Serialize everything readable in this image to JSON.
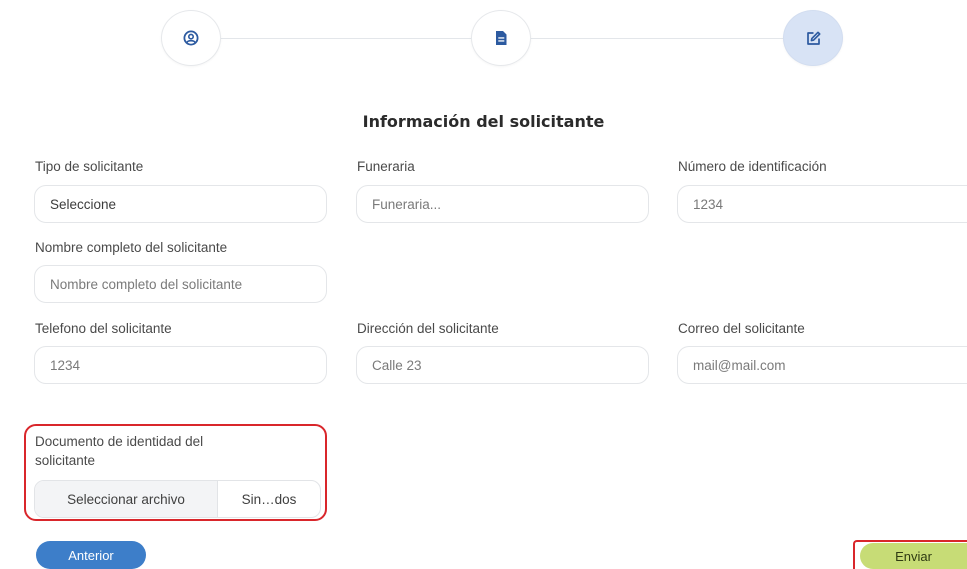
{
  "stepper": {
    "steps": [
      {
        "icon": "user-circle-icon",
        "active": false
      },
      {
        "icon": "document-icon",
        "active": false
      },
      {
        "icon": "edit-icon",
        "active": true
      }
    ],
    "active_color": "#d8e3f5",
    "icon_color": "#2c5aa0"
  },
  "form": {
    "title": "Información del solicitante",
    "tipo_solicitante": {
      "label": "Tipo de solicitante",
      "value": "Seleccione"
    },
    "funeraria": {
      "label": "Funeraria",
      "placeholder": "Funeraria..."
    },
    "numero_identificacion": {
      "label": "Número de identificación",
      "placeholder": "1234"
    },
    "nombre_completo": {
      "label": "Nombre completo del solicitante",
      "placeholder": "Nombre completo del solicitante"
    },
    "telefono": {
      "label": "Telefono del solicitante",
      "placeholder": "1234"
    },
    "direccion": {
      "label": "Dirección del solicitante",
      "placeholder": "Calle 23"
    },
    "correo": {
      "label": "Correo del solicitante",
      "placeholder": "mail@mail.com"
    },
    "documento": {
      "label_line1": "Documento de identidad del",
      "label_line2": "solicitante",
      "button_label": "Seleccionar archivo",
      "file_status": "Sin…dos"
    }
  },
  "actions": {
    "prev_label": "Anterior",
    "send_label": "Enviar",
    "prev_color": "#3d7ec9",
    "send_color": "#c7dc76",
    "highlight_color": "#d9262b"
  }
}
